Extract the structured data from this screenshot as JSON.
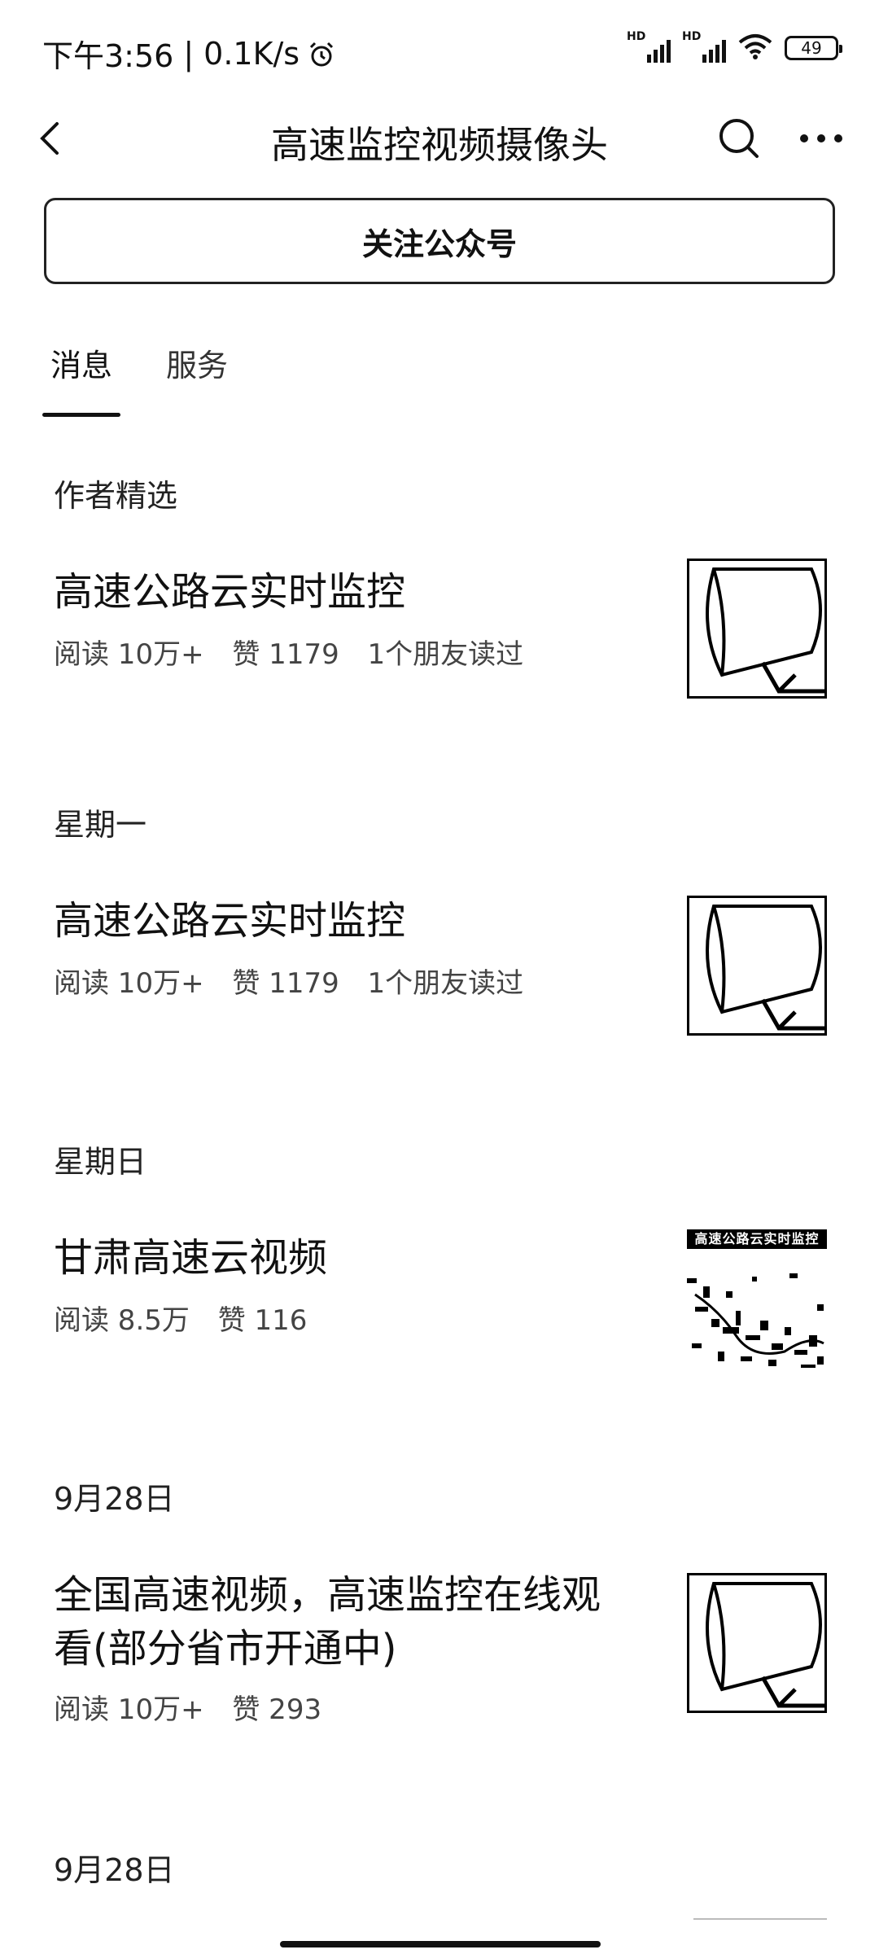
{
  "status_bar": {
    "time": "下午3:56",
    "separator": "|",
    "net_speed": "0.1K/s",
    "signal_1_label": "HD",
    "signal_2_label": "HD",
    "battery": "49",
    "icons": [
      "alarm-icon",
      "signal-icon",
      "signal-icon",
      "wifi-icon",
      "battery-icon"
    ]
  },
  "header": {
    "title": "高速监控视频摄像头",
    "icons": [
      "back-icon",
      "search-icon",
      "more-icon"
    ]
  },
  "follow_button": {
    "label": "关注公众号"
  },
  "tabs": [
    {
      "label": "消息",
      "active": true
    },
    {
      "label": "服务",
      "active": false
    }
  ],
  "sections": [
    {
      "heading": "作者精选",
      "articles": [
        {
          "title": "高速公路云实时监控",
          "reads": "阅读 10万+",
          "likes": "赞 1179",
          "friends": "1个朋友读过",
          "thumb": "camera-icon"
        }
      ]
    },
    {
      "heading": "星期一",
      "articles": [
        {
          "title": "高速公路云实时监控",
          "reads": "阅读 10万+",
          "likes": "赞 1179",
          "friends": "1个朋友读过",
          "thumb": "camera-icon"
        }
      ]
    },
    {
      "heading": "星期日",
      "articles": [
        {
          "title": "甘肃高速云视频",
          "reads": "阅读 8.5万",
          "likes": "赞 116",
          "thumb": "map-image",
          "thumb_caption": "高速公路云实时监控"
        }
      ]
    },
    {
      "heading": "9月28日",
      "articles": [
        {
          "title": "全国高速视频，高速监控在线观看(部分省市开通中)",
          "reads": "阅读 10万+",
          "likes": "赞 293",
          "thumb": "camera-icon"
        }
      ]
    },
    {
      "heading": "9月28日",
      "articles": []
    }
  ]
}
